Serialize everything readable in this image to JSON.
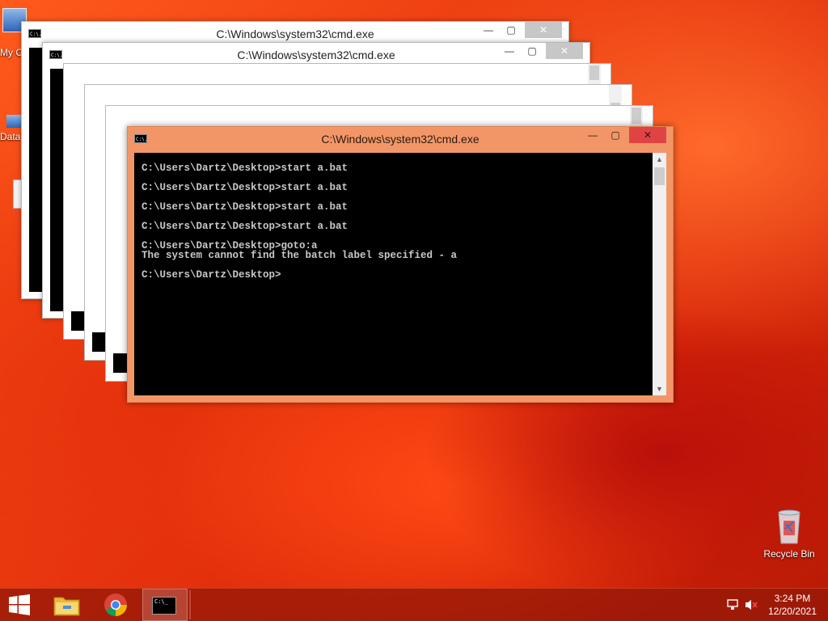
{
  "desktop": {
    "icons": [
      {
        "label": "My C"
      },
      {
        "label": "Data"
      },
      {
        "label": "Recycle Bin"
      }
    ]
  },
  "windows": {
    "bg_title_1": "C:\\Windows\\system32\\cmd.exe",
    "bg_title_2": "C:\\Windows\\system32\\cmd.exe",
    "active": {
      "title": "C:\\Windows\\system32\\cmd.exe",
      "lines": [
        "C:\\Users\\Dartz\\Desktop>start a.bat",
        "C:\\Users\\Dartz\\Desktop>start a.bat",
        "C:\\Users\\Dartz\\Desktop>start a.bat",
        "C:\\Users\\Dartz\\Desktop>start a.bat",
        "C:\\Users\\Dartz\\Desktop>goto:a",
        "The system cannot find the batch label specified - a",
        "C:\\Users\\Dartz\\Desktop>"
      ]
    },
    "controls": {
      "minimize": "—",
      "maximize": "▢",
      "close": "✕"
    },
    "app_icon_text": "C:\\."
  },
  "taskbar": {
    "time": "3:24 PM",
    "date": "12/20/2021",
    "apps": [
      "start-button",
      "file-explorer",
      "chrome",
      "command-prompt"
    ]
  },
  "colors": {
    "active_frame": "#f29668",
    "close_button": "#e04343",
    "console_bg": "#000000",
    "console_text": "#c8c8c8"
  }
}
